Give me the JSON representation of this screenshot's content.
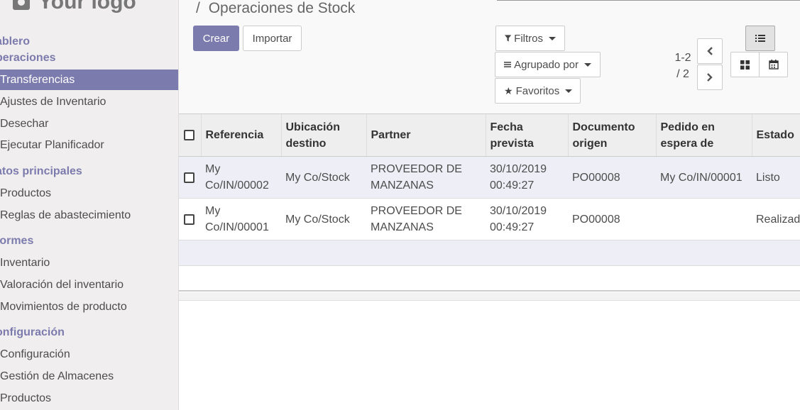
{
  "logo": {
    "text": "Your logo"
  },
  "sidebar": {
    "sections": [
      {
        "title": "ablero"
      },
      {
        "title": "peraciones"
      },
      {
        "title": "atos principales"
      },
      {
        "title": "formes"
      },
      {
        "title": "onfiguración"
      }
    ],
    "items": [
      {
        "label": "Transferencias"
      },
      {
        "label": "Ajustes de Inventario"
      },
      {
        "label": "Desechar"
      },
      {
        "label": "Ejecutar Planificador"
      },
      {
        "label": "Productos"
      },
      {
        "label": "Reglas de abastecimiento"
      },
      {
        "label": "Inventario"
      },
      {
        "label": "Valoración del inventario"
      },
      {
        "label": "Movimientos de producto"
      },
      {
        "label": "Configuración"
      },
      {
        "label": "Gestión de Almacenes"
      },
      {
        "label": "Productos"
      }
    ]
  },
  "breadcrumb": {
    "separator": "/",
    "title": "Operaciones de Stock"
  },
  "buttons": {
    "create": "Crear",
    "import": "Importar"
  },
  "search": {
    "filters": "Filtros",
    "group_by": "Agrupado por",
    "favorites": "Favoritos"
  },
  "pager": {
    "value_line1": "1-2",
    "value_line2": "/ 2"
  },
  "table": {
    "headers": [
      {
        "line1": "Referencia",
        "line2": ""
      },
      {
        "line1": "Ubicación",
        "line2": "destino"
      },
      {
        "line1": "Partner",
        "line2": ""
      },
      {
        "line1": "Fecha",
        "line2": "prevista"
      },
      {
        "line1": "Documento",
        "line2": "origen"
      },
      {
        "line1": "Pedido en",
        "line2": "espera de"
      },
      {
        "line1": "Estado",
        "line2": ""
      }
    ],
    "rows": [
      {
        "ref1": "My",
        "ref2": "Co/IN/00002",
        "dest": "My Co/Stock",
        "partner1": "PROVEEDOR DE",
        "partner2": "MANZANAS",
        "date1": "30/10/2019",
        "date2": "00:49:27",
        "origin": "PO00008",
        "waiting": "My Co/IN/00001",
        "state": "Listo"
      },
      {
        "ref1": "My",
        "ref2": "Co/IN/00001",
        "dest": "My Co/Stock",
        "partner1": "PROVEEDOR DE",
        "partner2": "MANZANAS",
        "date1": "30/10/2019",
        "date2": "00:49:27",
        "origin": "PO00008",
        "waiting": "",
        "state": "Realizad"
      }
    ]
  },
  "colors": {
    "accent": "#7c7bad",
    "sidebar_bg": "#f0eeee",
    "header_bg": "#eeeeee",
    "selected_row": "#eeeef6"
  },
  "icons": {
    "filter": "filter-icon",
    "group": "bars-icon",
    "favorites": "star-icon",
    "prev": "chevron-left-icon",
    "next": "chevron-right-icon",
    "list": "list-icon",
    "kanban": "grid-icon",
    "calendar": "calendar-icon",
    "logo": "camera-icon"
  }
}
